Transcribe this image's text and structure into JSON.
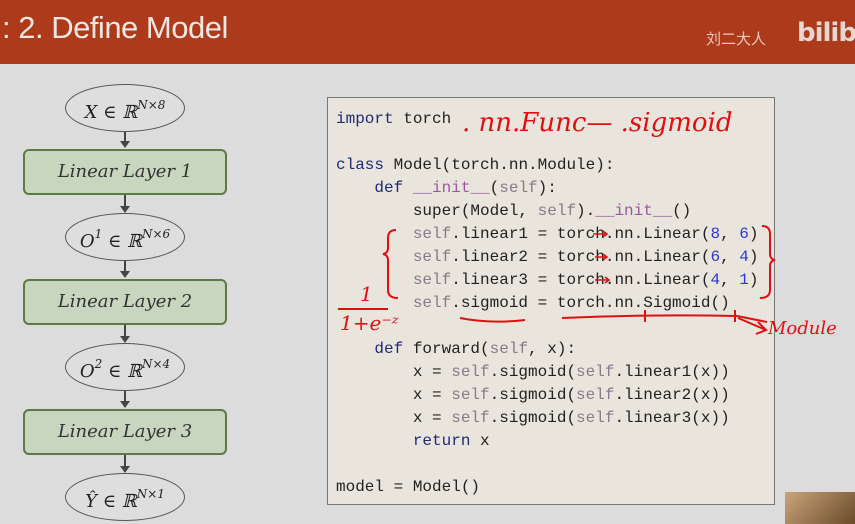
{
  "header": {
    "title": ": 2. Define Model",
    "watermark": "刘二大人",
    "logo": "bilibili"
  },
  "flow": {
    "nodes": [
      {
        "type": "data",
        "var": "X",
        "sup": "N×8"
      },
      {
        "type": "layer",
        "label": "Linear Layer 1"
      },
      {
        "type": "data",
        "var": "O",
        "idx": "1",
        "sup": "N×6"
      },
      {
        "type": "layer",
        "label": "Linear Layer 2"
      },
      {
        "type": "data",
        "var": "O",
        "idx": "2",
        "sup": "N×4"
      },
      {
        "type": "layer",
        "label": "Linear Layer 3"
      },
      {
        "type": "data",
        "var": "Ŷ",
        "sup": "N×1"
      }
    ],
    "set_symbol": "∈ ℝ"
  },
  "code": {
    "lines": [
      "import torch",
      "",
      "class Model(torch.nn.Module):",
      "    def __init__(self):",
      "        super(Model, self).__init__()",
      "        self.linear1 = torch.nn.Linear(8, 6)",
      "        self.linear2 = torch.nn.Linear(6, 4)",
      "        self.linear3 = torch.nn.Linear(4, 1)",
      "        self.sigmoid = torch.nn.Sigmoid()",
      "",
      "    def forward(self, x):",
      "        x = self.sigmoid(self.linear1(x))",
      "        x = self.sigmoid(self.linear2(x))",
      "        x = self.sigmoid(self.linear3(x))",
      "        return x",
      "",
      "model = Model()"
    ]
  },
  "annotations": {
    "top": ". nn.Func— .sigmoid",
    "formula_num": "1",
    "formula_den": "1+e⁻ᶻ",
    "module": "Module"
  },
  "colors": {
    "header": "#ad3a1a",
    "layer_fill": "#c8d6c0",
    "ink": "#e01010"
  }
}
